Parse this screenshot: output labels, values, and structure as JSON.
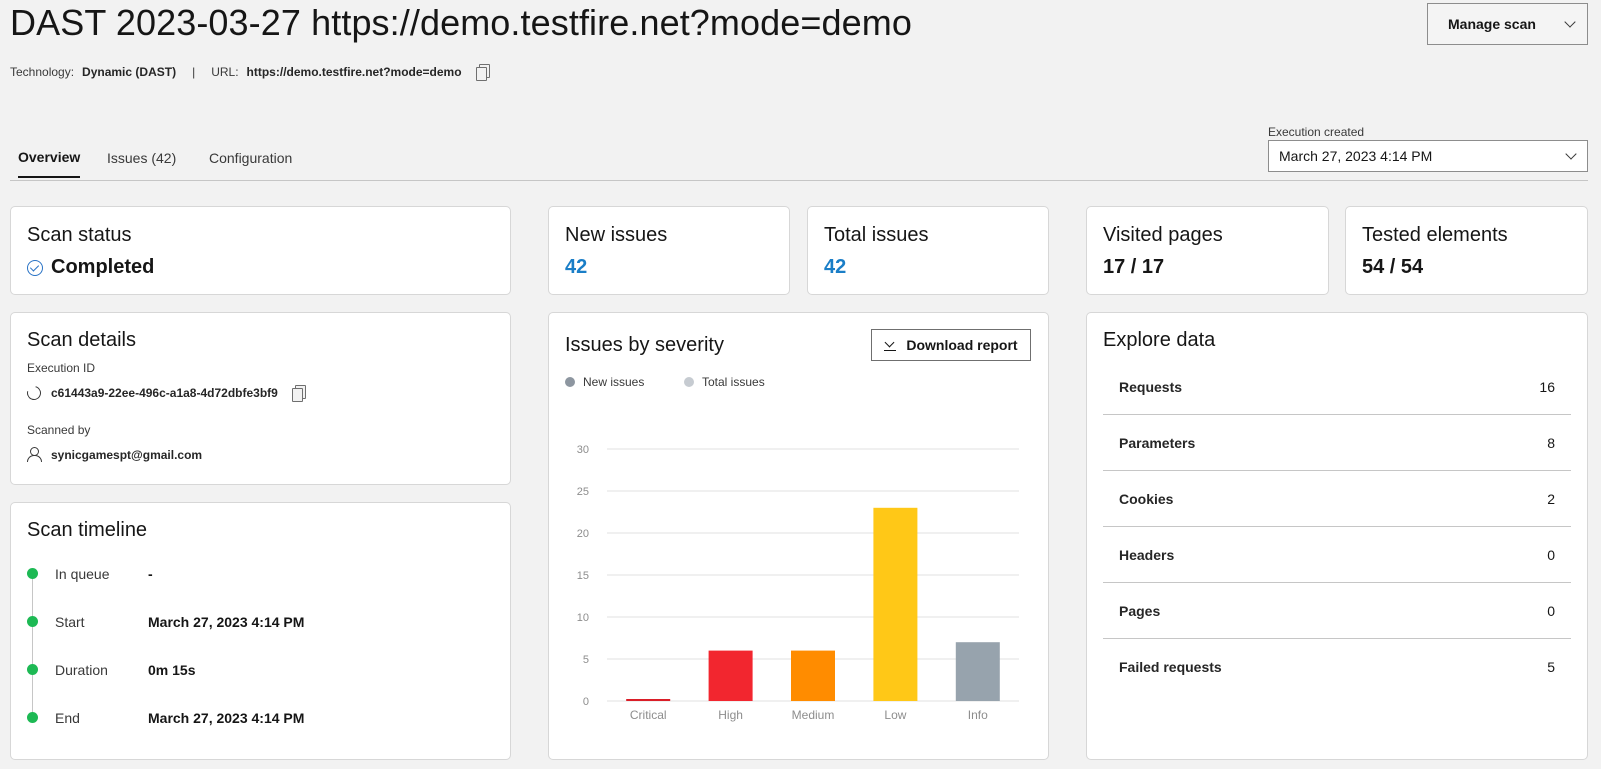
{
  "header": {
    "title": "DAST 2023-03-27 https://demo.testfire.net?mode=demo",
    "technology_label": "Technology:",
    "technology_value": "Dynamic (DAST)",
    "separator": "|",
    "url_label": "URL:",
    "url_value": "https://demo.testfire.net?mode=demo",
    "manage_button": "Manage scan"
  },
  "tabs": [
    {
      "label": "Overview",
      "active": true
    },
    {
      "label": "Issues (42)",
      "active": false
    },
    {
      "label": "Configuration",
      "active": false
    }
  ],
  "execution": {
    "label": "Execution created",
    "selected": "March 27, 2023 4:14 PM"
  },
  "cards": {
    "scan_status": {
      "title": "Scan status",
      "value": "Completed"
    },
    "new_issues": {
      "title": "New issues",
      "value": "42"
    },
    "total_issues": {
      "title": "Total issues",
      "value": "42"
    },
    "visited_pages": {
      "title": "Visited pages",
      "value": "17 / 17"
    },
    "tested_elements": {
      "title": "Tested elements",
      "value": "54 / 54"
    }
  },
  "scan_details": {
    "title": "Scan details",
    "execution_id_label": "Execution ID",
    "execution_id": "c61443a9-22ee-496c-a1a8-4d72dbfe3bf9",
    "scanned_by_label": "Scanned by",
    "scanned_by": "synicgamespt@gmail.com"
  },
  "timeline": {
    "title": "Scan timeline",
    "items": [
      {
        "label": "In queue",
        "value": "-"
      },
      {
        "label": "Start",
        "value": "March 27, 2023 4:14 PM"
      },
      {
        "label": "Duration",
        "value": "0m 15s"
      },
      {
        "label": "End",
        "value": "March 27, 2023 4:14 PM"
      }
    ]
  },
  "severity": {
    "title": "Issues by severity",
    "download_button": "Download report",
    "legend": [
      {
        "name": "New issues",
        "color": "#8d96a0"
      },
      {
        "name": "Total issues",
        "color": "#c6cbd1"
      }
    ]
  },
  "chart_data": {
    "type": "bar",
    "categories": [
      "Critical",
      "High",
      "Medium",
      "Low",
      "Info"
    ],
    "values": [
      0,
      6,
      6,
      23,
      7
    ],
    "colors": [
      "#da1e28",
      "#f2262f",
      "#ff8c00",
      "#ffc817",
      "#97a3ad"
    ],
    "yticks": [
      0,
      5,
      10,
      15,
      20,
      25,
      30
    ],
    "ylim": [
      0,
      30
    ],
    "grid": true
  },
  "explore": {
    "title": "Explore data",
    "rows": [
      {
        "label": "Requests",
        "value": "16"
      },
      {
        "label": "Parameters",
        "value": "8"
      },
      {
        "label": "Cookies",
        "value": "2"
      },
      {
        "label": "Headers",
        "value": "0"
      },
      {
        "label": "Pages",
        "value": "0"
      },
      {
        "label": "Failed requests",
        "value": "5"
      }
    ]
  }
}
